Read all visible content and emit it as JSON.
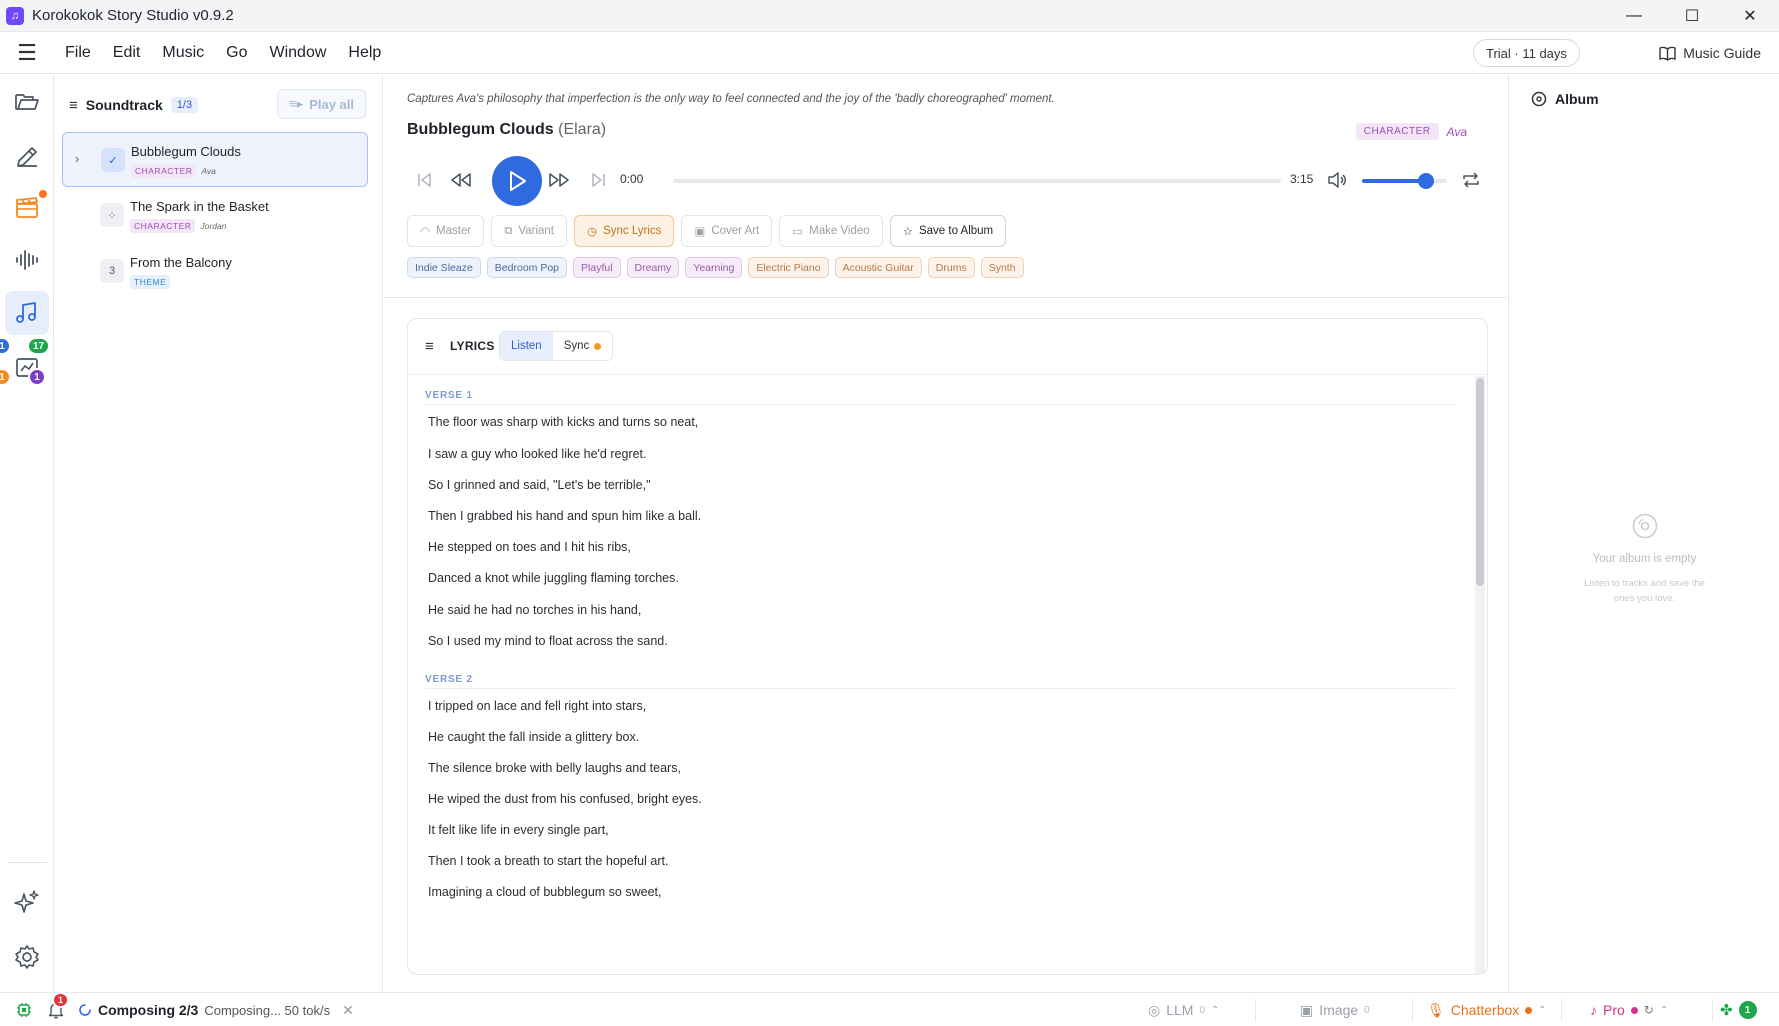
{
  "window": {
    "title": "Korokokok Story Studio v0.9.2",
    "minimize": "—",
    "maximize": "☐",
    "close": "✕"
  },
  "menubar": {
    "items": [
      "File",
      "Edit",
      "Music",
      "Go",
      "Window",
      "Help"
    ],
    "trial": "Trial · 11 days",
    "guide": "Music Guide"
  },
  "rail": {
    "badges": {
      "blue": "1",
      "green": "17",
      "orange": "1",
      "purple": "1"
    }
  },
  "soundtrack": {
    "title": "Soundtrack",
    "count": "1/3",
    "play_all": "Play all",
    "tracks": [
      {
        "status": "✓",
        "name": "Bubblegum Clouds",
        "tag": "CHARACTER",
        "owner": "Ava"
      },
      {
        "status": "⁘",
        "name": "The Spark in the Basket",
        "tag": "CHARACTER",
        "owner": "Jordan"
      },
      {
        "status": "3",
        "name": "From the Balcony",
        "tag": "THEME",
        "owner": ""
      }
    ]
  },
  "song": {
    "caption": "Captures Ava's philosophy that imperfection is the only way to feel connected and the joy of the 'badly choreographed' moment.",
    "title": "Bubblegum Clouds",
    "subtitle": "(Elara)",
    "tag": "CHARACTER",
    "owner": "Ava",
    "time_current": "0:00",
    "time_total": "3:15",
    "progress": 0,
    "volume": 0.75
  },
  "actions": {
    "master": "Master",
    "variant": "Variant",
    "sync": "Sync Lyrics",
    "cover": "Cover Art",
    "video": "Make Video",
    "save": "Save to Album"
  },
  "genres": [
    {
      "label": "Indie Sleaze",
      "color": "blue"
    },
    {
      "label": "Bedroom Pop",
      "color": "blue"
    },
    {
      "label": "Playful",
      "color": "purple"
    },
    {
      "label": "Dreamy",
      "color": "purple"
    },
    {
      "label": "Yearning",
      "color": "purple"
    },
    {
      "label": "Electric Piano",
      "color": "orange"
    },
    {
      "label": "Acoustic Guitar",
      "color": "orange"
    },
    {
      "label": "Drums",
      "color": "orange"
    },
    {
      "label": "Synth",
      "color": "orange"
    }
  ],
  "lyrics": {
    "title": "LYRICS",
    "tab_listen": "Listen",
    "tab_sync": "Sync",
    "verse1_label": "VERSE 1",
    "verse1": [
      "The floor was sharp with kicks and turns so neat,",
      "I saw a guy who looked like he'd regret.",
      "So I grinned and said, \"Let's be terrible,\"",
      "Then I grabbed his hand and spun him like a ball.",
      "He stepped on toes and I hit his ribs,",
      "Danced a knot while juggling flaming torches.",
      "He said he had no torches in his hand,",
      "So I used my mind to float across the sand."
    ],
    "verse2_label": "VERSE 2",
    "verse2": [
      "I tripped on lace and fell right into stars,",
      "He caught the fall inside a glittery box.",
      "The silence broke with belly laughs and tears,",
      "He wiped the dust from his confused, bright eyes.",
      "It felt like life in every single part,",
      "Then I took a breath to start the hopeful art.",
      "Imagining a cloud of bubblegum so sweet,"
    ]
  },
  "album": {
    "title": "Album",
    "empty_title": "Your album is empty",
    "empty_line1": "Listen to tracks and save the",
    "empty_line2": "ones you love."
  },
  "statusbar": {
    "bell_badge": "1",
    "composing": "Composing 2/3",
    "composing_detail": "Composing... 50 tok/s",
    "llm": "LLM",
    "llm_count": "0",
    "image": "Image",
    "image_count": "0",
    "chatterbox": "Chatterbox",
    "pro": "Pro",
    "right_badge": "1"
  },
  "colors": {
    "accent": "#2f6ae0",
    "sync_orange": "#c2741d",
    "character_purple": "#a04cb8",
    "chatterbox_orange": "#e8721c",
    "pro_pink": "#d6338a"
  }
}
